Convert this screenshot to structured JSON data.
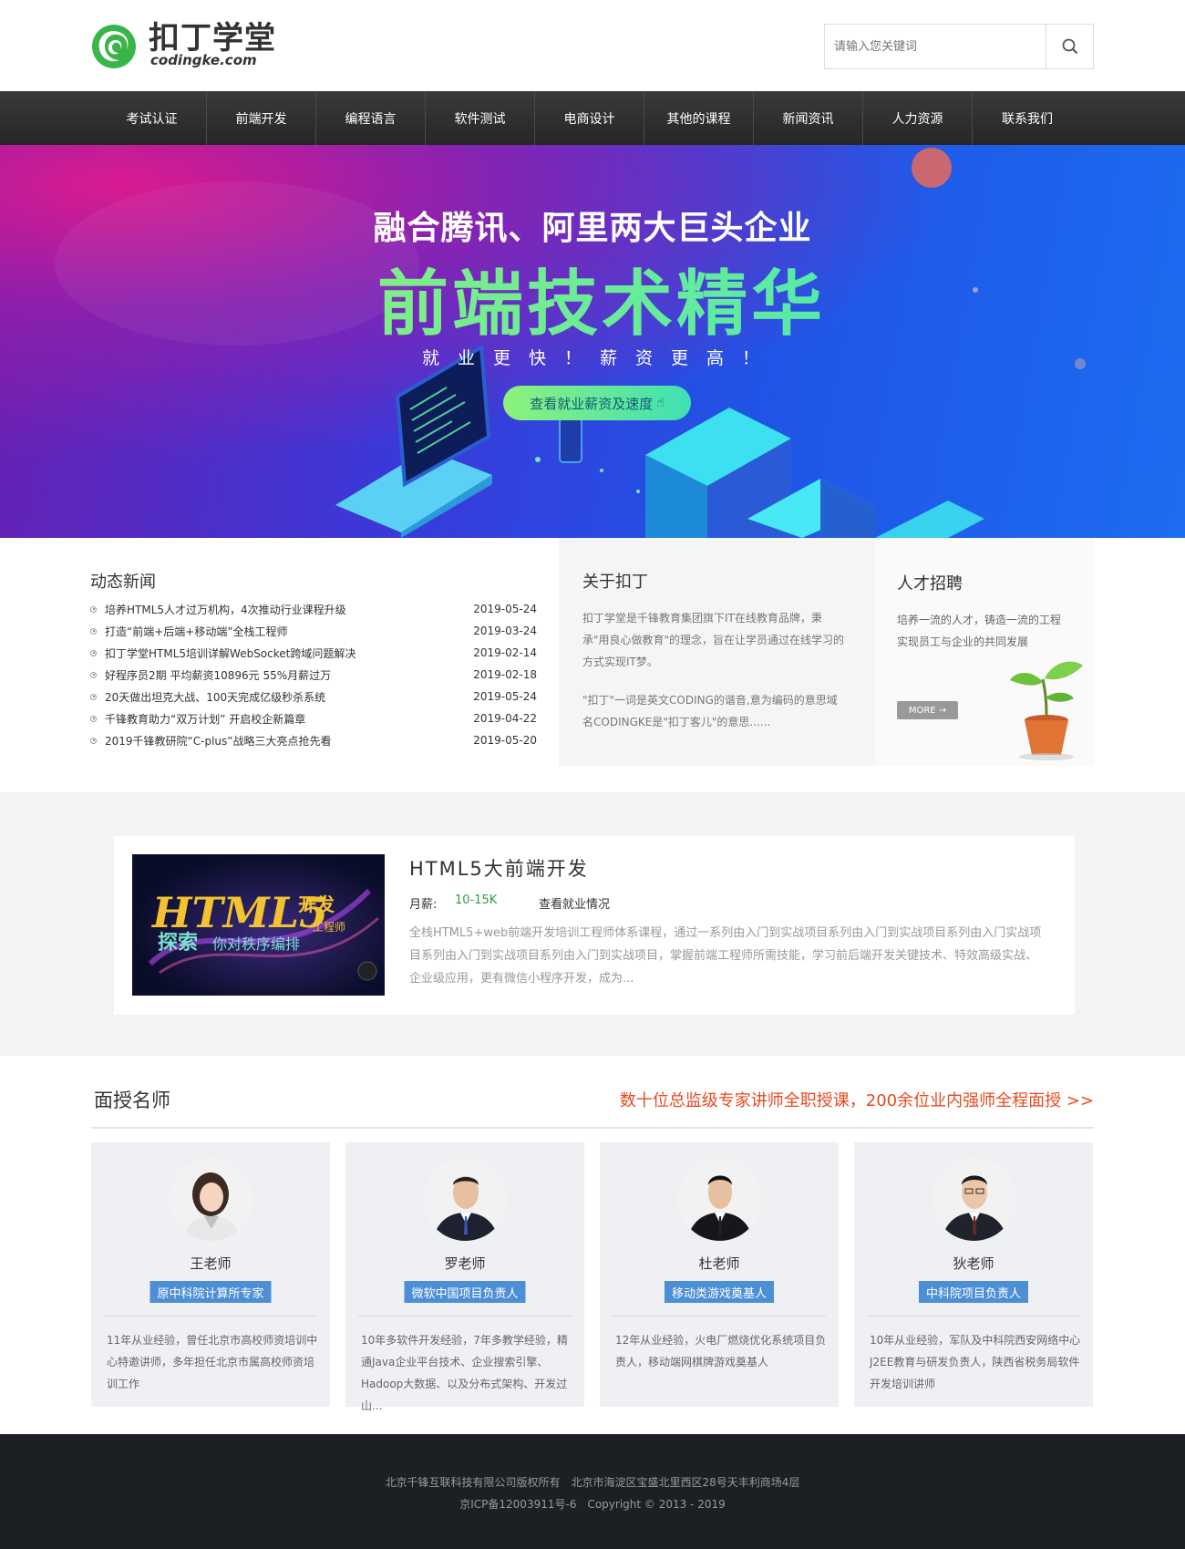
{
  "header": {
    "logo_cn": "扣丁学堂",
    "logo_en": "codingke.com",
    "search_placeholder": "请输入您关键词"
  },
  "nav": [
    "考试认证",
    "前端开发",
    "编程语言",
    "软件测试",
    "电商设计",
    "其他的课程",
    "新闻资讯",
    "人力资源",
    "联系我们"
  ],
  "banner": {
    "headline": "融合腾讯、阿里两大巨头企业",
    "big": "前端技术精华",
    "sub": "就业更快！薪资更高！",
    "cta": "查看就业薪资及速度"
  },
  "news": {
    "title": "动态新闻",
    "items": [
      {
        "text": "培养HTML5人才过万机构，4次推动行业课程升级",
        "date": "2019-05-24"
      },
      {
        "text": "打造“前端+后端+移动端”全栈工程师",
        "date": "2019-03-24"
      },
      {
        "text": "扣丁学堂HTML5培训详解WebSocket跨域问题解决",
        "date": "2019-02-14"
      },
      {
        "text": "好程序员2期 平均薪资10896元 55%月薪过万",
        "date": "2019-02-18"
      },
      {
        "text": "20天做出坦克大战、100天完成亿级秒杀系统",
        "date": "2019-05-24"
      },
      {
        "text": "千锋教育助力“双万计划” 开启校企新篇章",
        "date": "2019-04-22"
      },
      {
        "text": "2019千锋教研院“C-plus”战略三大亮点抢先看",
        "date": "2019-05-20"
      }
    ]
  },
  "about": {
    "title": "关于扣丁",
    "p1": "扣丁学堂是千锋教育集团旗下IT在线教育品牌，秉承\"用良心做教育\"的理念，旨在让学员通过在线学习的方式实现IT梦。",
    "p2": "\"扣丁\"一词是英文CODING的谐音,意为编码的意思域名CODINGKE是\"扣丁客儿\"的意思......"
  },
  "recruit": {
    "title": "人才招聘",
    "text": "培养一流的人才，铸造一流的工程实现员工与企业的共同发展",
    "more": "MORE →"
  },
  "course": {
    "image_text_1": "HTML5",
    "image_text_2": "开发",
    "image_text_3": "工程师",
    "image_text_4": "探索",
    "image_text_5": "你对秩序编排",
    "name": "HTML5大前端开发",
    "salary_label": "月薪:",
    "salary_value": "10-15K",
    "salary_link": "查看就业情况",
    "desc": "全栈HTML5+web前端开发培训工程师体系课程，通过一系列由入门到实战项目系列由入门到实战项目系列由入门实战项目系列由入门到实战项目系列由入门到实战项目，掌握前端工程师所需技能，学习前后端开发关键技术、特效高级实战、企业级应用，更有微信小程序开发，成为..."
  },
  "teachers": {
    "title": "面授名师",
    "slogan": "数十位总监级专家讲师全职授课，200余位业内强师全程面授 >>",
    "list": [
      {
        "name": "王老师",
        "tag": "原中科院计算所专家",
        "desc": "11年从业经验，曾任北京市高校师资培训中心特邀讲师，多年担任北京市属高校师资培训工作"
      },
      {
        "name": "罗老师",
        "tag": "微软中国项目负责人",
        "desc": "10年多软件开发经验，7年多教学经验，精通Java企业平台技术、企业搜索引擎、Hadoop大数据、以及分布式架构、开发过山..."
      },
      {
        "name": "杜老师",
        "tag": "移动类游戏奠基人",
        "desc": "12年从业经验，火电厂燃烧优化系统项目负责人，移动端网棋牌游戏奠基人"
      },
      {
        "name": "狄老师",
        "tag": "中科院项目负责人",
        "desc": "10年从业经验，军队及中科院西安网络中心J2EE教育与研发负责人，陕西省税务局软件开发培训讲师"
      }
    ]
  },
  "footer": {
    "line1": "北京千锋互联科技有限公司版权所有　北京市海淀区宝盛北里西区28号天丰利商场4层",
    "line2": "京ICP备12003911号-6　Copyright © 2013 - 2019"
  },
  "colors": {
    "nav_bg": "#2e2e2e",
    "accent_green": "#2ba245",
    "slogan_red": "#e8481e",
    "tag_blue": "#4d8fd5",
    "footer_bg": "#1c2025"
  }
}
